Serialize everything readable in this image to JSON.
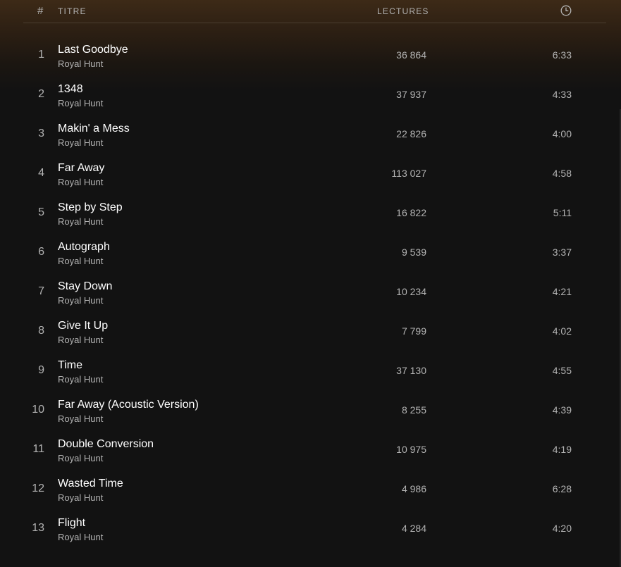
{
  "header": {
    "number_label": "#",
    "title_label": "TITRE",
    "plays_label": "LECTURES",
    "duration_icon": "clock-icon"
  },
  "tracks": [
    {
      "number": "1",
      "title": "Last Goodbye",
      "artist": "Royal Hunt",
      "plays": "36 864",
      "duration": "6:33"
    },
    {
      "number": "2",
      "title": "1348",
      "artist": "Royal Hunt",
      "plays": "37 937",
      "duration": "4:33"
    },
    {
      "number": "3",
      "title": "Makin' a Mess",
      "artist": "Royal Hunt",
      "plays": "22 826",
      "duration": "4:00"
    },
    {
      "number": "4",
      "title": "Far Away",
      "artist": "Royal Hunt",
      "plays": "113 027",
      "duration": "4:58"
    },
    {
      "number": "5",
      "title": "Step by Step",
      "artist": "Royal Hunt",
      "plays": "16 822",
      "duration": "5:11"
    },
    {
      "number": "6",
      "title": "Autograph",
      "artist": "Royal Hunt",
      "plays": "9 539",
      "duration": "3:37"
    },
    {
      "number": "7",
      "title": "Stay Down",
      "artist": "Royal Hunt",
      "plays": "10 234",
      "duration": "4:21"
    },
    {
      "number": "8",
      "title": "Give It Up",
      "artist": "Royal Hunt",
      "plays": "7 799",
      "duration": "4:02"
    },
    {
      "number": "9",
      "title": "Time",
      "artist": "Royal Hunt",
      "plays": "37 130",
      "duration": "4:55"
    },
    {
      "number": "10",
      "title": "Far Away (Acoustic Version)",
      "artist": "Royal Hunt",
      "plays": "8 255",
      "duration": "4:39"
    },
    {
      "number": "11",
      "title": "Double Conversion",
      "artist": "Royal Hunt",
      "plays": "10 975",
      "duration": "4:19"
    },
    {
      "number": "12",
      "title": "Wasted Time",
      "artist": "Royal Hunt",
      "plays": "4 986",
      "duration": "6:28"
    },
    {
      "number": "13",
      "title": "Flight",
      "artist": "Royal Hunt",
      "plays": "4 284",
      "duration": "4:20"
    }
  ],
  "colors": {
    "background": "#121212",
    "gradient_top": "#3d2a17",
    "primary_text": "#ffffff",
    "secondary_text": "#b3b3b3"
  }
}
